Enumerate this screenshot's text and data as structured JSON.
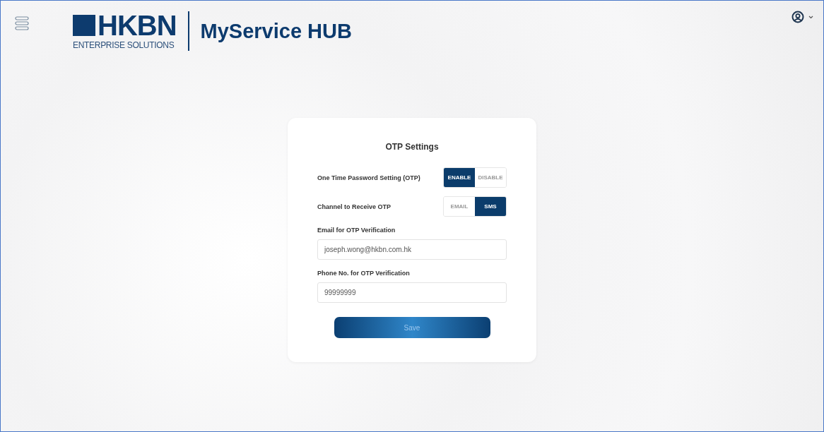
{
  "header": {
    "brand": "HKBN",
    "brand_subtitle": "ENTERPRISE SOLUTIONS",
    "product": "MyService HUB"
  },
  "card": {
    "title": "OTP Settings",
    "toggles": [
      {
        "label": "One Time Password Setting (OTP)",
        "options": [
          {
            "label": "ENABLE",
            "selected": true
          },
          {
            "label": "DISABLE",
            "selected": false
          }
        ]
      },
      {
        "label": "Channel to Receive OTP",
        "options": [
          {
            "label": "EMAIL",
            "selected": false
          },
          {
            "label": "SMS",
            "selected": true
          }
        ]
      }
    ],
    "fields": [
      {
        "label": "Email for OTP Verification",
        "value": "joseph.wong@hkbn.com.hk"
      },
      {
        "label": "Phone No. for OTP Verification",
        "value": "99999999"
      }
    ],
    "button": "Save"
  }
}
